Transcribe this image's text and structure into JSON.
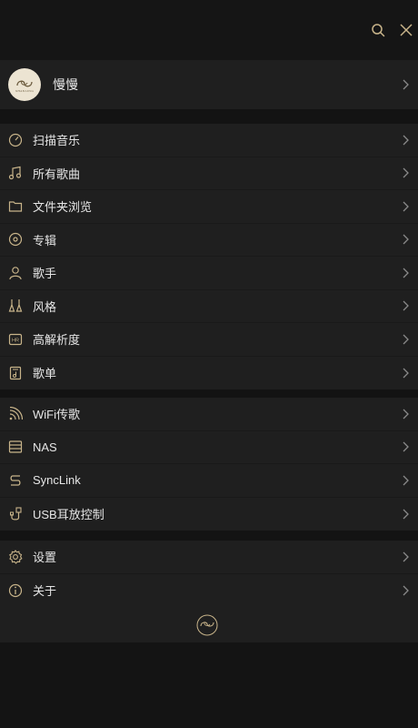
{
  "header": {
    "search_icon": "search-icon",
    "close_icon": "close-icon"
  },
  "profile": {
    "name": "慢慢",
    "avatar_icon": "shanling-logo-icon",
    "logo_text": "SHANLING"
  },
  "colors": {
    "accent_gold": "#c8b48a",
    "background": "#131313",
    "row_background": "#1f1f1f"
  },
  "library": {
    "items": [
      {
        "label": "扫描音乐",
        "icon": "scan-icon"
      },
      {
        "label": "所有歌曲",
        "icon": "music-note-icon"
      },
      {
        "label": "文件夹浏览",
        "icon": "folder-icon"
      },
      {
        "label": "专辑",
        "icon": "album-icon"
      },
      {
        "label": "歌手",
        "icon": "artist-icon"
      },
      {
        "label": "风格",
        "icon": "genre-icon"
      },
      {
        "label": "高解析度",
        "icon": "hires-icon"
      },
      {
        "label": "歌单",
        "icon": "playlist-icon"
      }
    ]
  },
  "network": {
    "items": [
      {
        "label": "WiFi传歌",
        "icon": "wifi-icon"
      },
      {
        "label": "NAS",
        "icon": "nas-icon"
      },
      {
        "label": "SyncLink",
        "icon": "synclink-icon"
      },
      {
        "label": "USB耳放控制",
        "icon": "usb-icon"
      }
    ]
  },
  "system": {
    "items": [
      {
        "label": "设置",
        "icon": "settings-icon"
      },
      {
        "label": "关于",
        "icon": "info-icon"
      }
    ]
  },
  "footer": {
    "logo_icon": "shanling-logo-icon"
  }
}
